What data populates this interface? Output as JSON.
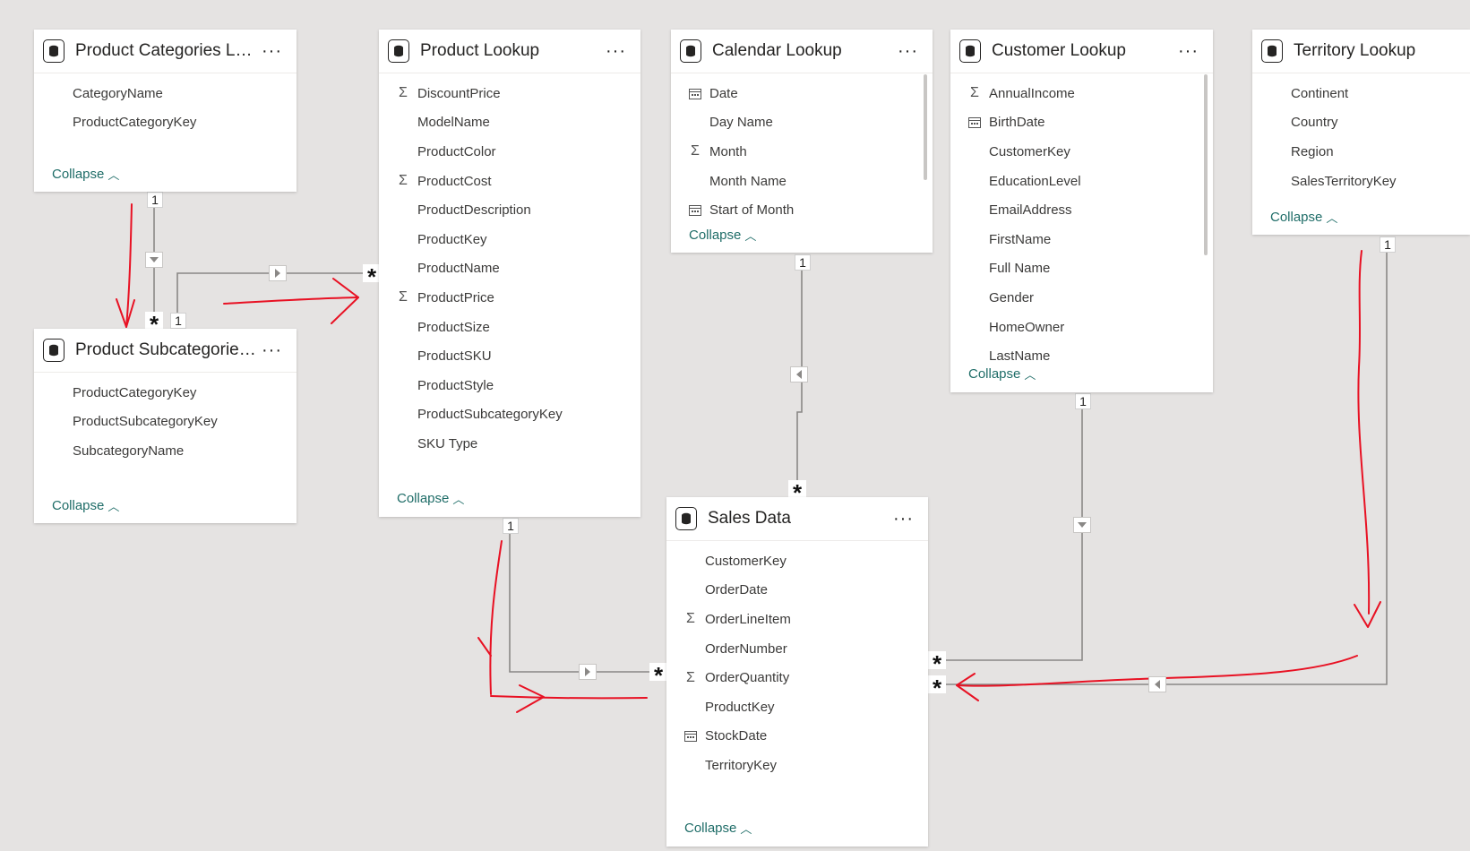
{
  "tables": {
    "product_categories": {
      "title": "Product Categories Loo...",
      "fields": [
        "CategoryName",
        "ProductCategoryKey"
      ],
      "collapse": "Collapse"
    },
    "product_subcategories": {
      "title": "Product Subcategories ...",
      "fields": [
        "ProductCategoryKey",
        "ProductSubcategoryKey",
        "SubcategoryName"
      ],
      "collapse": "Collapse"
    },
    "product_lookup": {
      "title": "Product Lookup",
      "fields": [
        {
          "name": "DiscountPrice",
          "icon": "sigma"
        },
        {
          "name": "ModelName",
          "icon": ""
        },
        {
          "name": "ProductColor",
          "icon": ""
        },
        {
          "name": "ProductCost",
          "icon": "sigma"
        },
        {
          "name": "ProductDescription",
          "icon": ""
        },
        {
          "name": "ProductKey",
          "icon": ""
        },
        {
          "name": "ProductName",
          "icon": ""
        },
        {
          "name": "ProductPrice",
          "icon": "sigma"
        },
        {
          "name": "ProductSize",
          "icon": ""
        },
        {
          "name": "ProductSKU",
          "icon": ""
        },
        {
          "name": "ProductStyle",
          "icon": ""
        },
        {
          "name": "ProductSubcategoryKey",
          "icon": ""
        },
        {
          "name": "SKU Type",
          "icon": ""
        }
      ],
      "collapse": "Collapse"
    },
    "calendar_lookup": {
      "title": "Calendar Lookup",
      "fields": [
        {
          "name": "Date",
          "icon": "calendar"
        },
        {
          "name": "Day Name",
          "icon": ""
        },
        {
          "name": "Month",
          "icon": "sigma"
        },
        {
          "name": "Month Name",
          "icon": ""
        },
        {
          "name": "Start of Month",
          "icon": "calendar"
        }
      ],
      "collapse": "Collapse"
    },
    "customer_lookup": {
      "title": "Customer Lookup",
      "fields": [
        {
          "name": "AnnualIncome",
          "icon": "sigma"
        },
        {
          "name": "BirthDate",
          "icon": "calendar"
        },
        {
          "name": "CustomerKey",
          "icon": ""
        },
        {
          "name": "EducationLevel",
          "icon": ""
        },
        {
          "name": "EmailAddress",
          "icon": ""
        },
        {
          "name": "FirstName",
          "icon": ""
        },
        {
          "name": "Full Name",
          "icon": ""
        },
        {
          "name": "Gender",
          "icon": ""
        },
        {
          "name": "HomeOwner",
          "icon": ""
        },
        {
          "name": "LastName",
          "icon": ""
        }
      ],
      "collapse": "Collapse"
    },
    "territory_lookup": {
      "title": "Territory Lookup",
      "fields": [
        "Continent",
        "Country",
        "Region",
        "SalesTerritoryKey"
      ],
      "collapse": "Collapse"
    },
    "sales_data": {
      "title": "Sales Data",
      "fields": [
        {
          "name": "CustomerKey",
          "icon": ""
        },
        {
          "name": "OrderDate",
          "icon": ""
        },
        {
          "name": "OrderLineItem",
          "icon": "sigma"
        },
        {
          "name": "OrderNumber",
          "icon": ""
        },
        {
          "name": "OrderQuantity",
          "icon": "sigma"
        },
        {
          "name": "ProductKey",
          "icon": ""
        },
        {
          "name": "StockDate",
          "icon": "calendar"
        },
        {
          "name": "TerritoryKey",
          "icon": ""
        }
      ],
      "collapse": "Collapse"
    }
  },
  "cardinality": {
    "one": "1",
    "many": "*"
  },
  "more_menu": "···",
  "colors": {
    "canvas": "#e5e3e2",
    "relationship_line": "#8a8886",
    "annotation": "#e81123",
    "collapse_link": "#1f6d68"
  },
  "icons": {
    "table": "database-icon",
    "sigma": "sigma-icon",
    "calendar": "calendar-icon",
    "collapse": "chevron-up-icon"
  }
}
